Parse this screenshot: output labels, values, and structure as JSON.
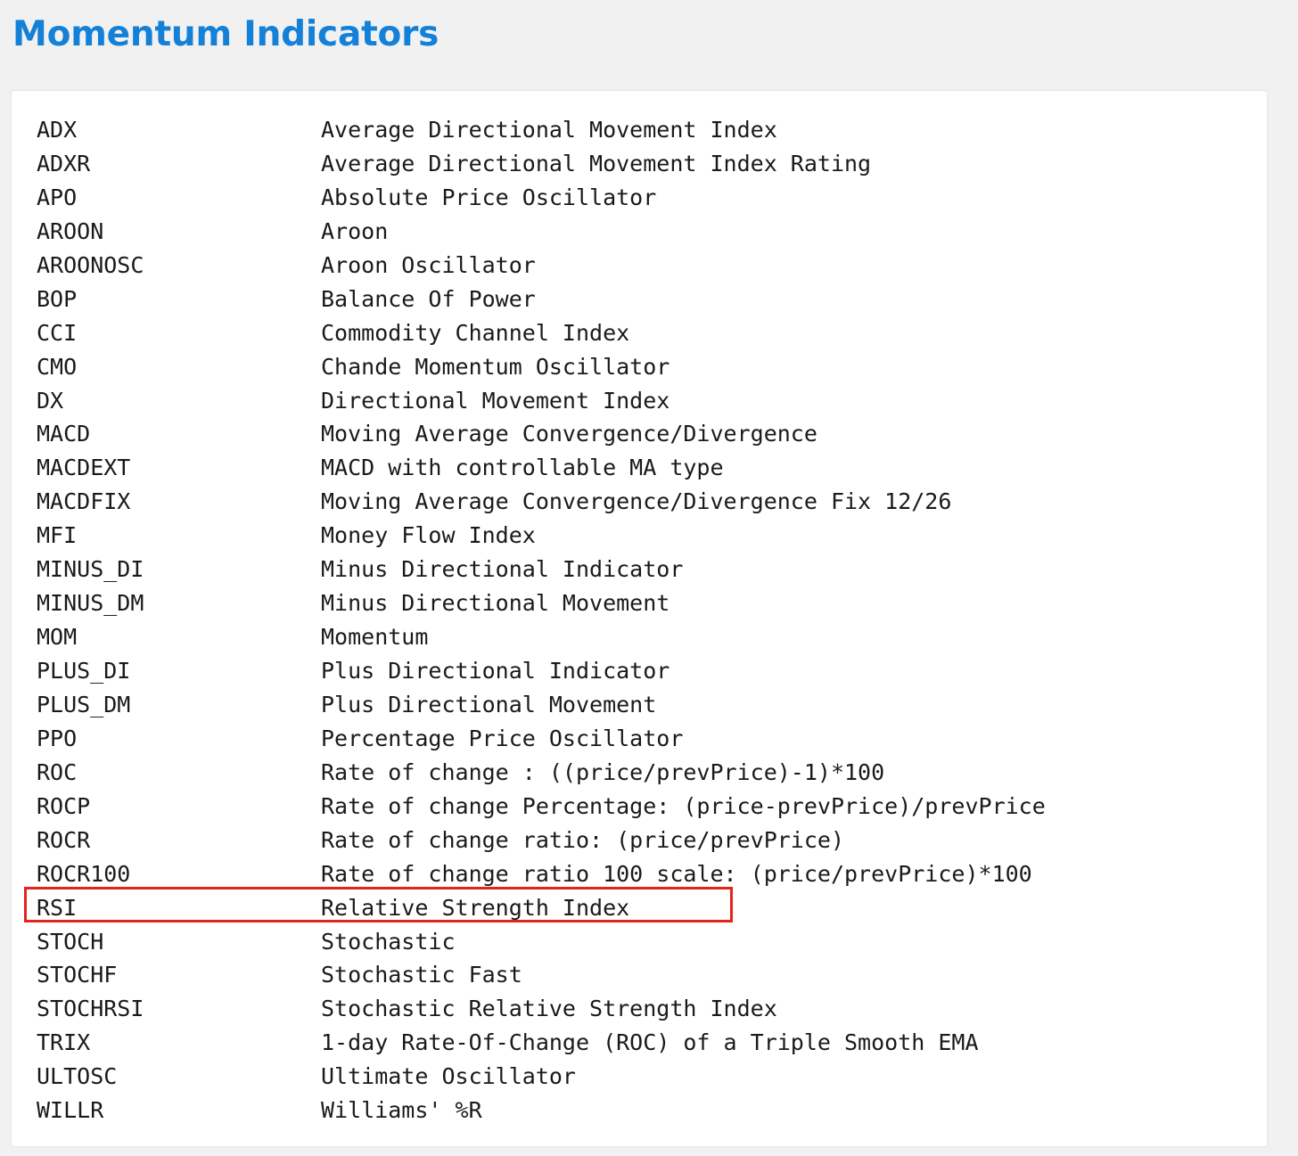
{
  "page": {
    "title": "Momentum Indicators",
    "title_color": "#1480d8",
    "highlight_color": "#e3251b",
    "highlighted_code": "RSI"
  },
  "indicators": [
    {
      "code": "ADX",
      "description": "Average Directional Movement Index"
    },
    {
      "code": "ADXR",
      "description": "Average Directional Movement Index Rating"
    },
    {
      "code": "APO",
      "description": "Absolute Price Oscillator"
    },
    {
      "code": "AROON",
      "description": "Aroon"
    },
    {
      "code": "AROONOSC",
      "description": "Aroon Oscillator"
    },
    {
      "code": "BOP",
      "description": "Balance Of Power"
    },
    {
      "code": "CCI",
      "description": "Commodity Channel Index"
    },
    {
      "code": "CMO",
      "description": "Chande Momentum Oscillator"
    },
    {
      "code": "DX",
      "description": "Directional Movement Index"
    },
    {
      "code": "MACD",
      "description": "Moving Average Convergence/Divergence"
    },
    {
      "code": "MACDEXT",
      "description": "MACD with controllable MA type"
    },
    {
      "code": "MACDFIX",
      "description": "Moving Average Convergence/Divergence Fix 12/26"
    },
    {
      "code": "MFI",
      "description": "Money Flow Index"
    },
    {
      "code": "MINUS_DI",
      "description": "Minus Directional Indicator"
    },
    {
      "code": "MINUS_DM",
      "description": "Minus Directional Movement"
    },
    {
      "code": "MOM",
      "description": "Momentum"
    },
    {
      "code": "PLUS_DI",
      "description": "Plus Directional Indicator"
    },
    {
      "code": "PLUS_DM",
      "description": "Plus Directional Movement"
    },
    {
      "code": "PPO",
      "description": "Percentage Price Oscillator"
    },
    {
      "code": "ROC",
      "description": "Rate of change : ((price/prevPrice)-1)*100"
    },
    {
      "code": "ROCP",
      "description": "Rate of change Percentage: (price-prevPrice)/prevPrice"
    },
    {
      "code": "ROCR",
      "description": "Rate of change ratio: (price/prevPrice)"
    },
    {
      "code": "ROCR100",
      "description": "Rate of change ratio 100 scale: (price/prevPrice)*100"
    },
    {
      "code": "RSI",
      "description": "Relative Strength Index"
    },
    {
      "code": "STOCH",
      "description": "Stochastic"
    },
    {
      "code": "STOCHF",
      "description": "Stochastic Fast"
    },
    {
      "code": "STOCHRSI",
      "description": "Stochastic Relative Strength Index"
    },
    {
      "code": "TRIX",
      "description": "1-day Rate-Of-Change (ROC) of a Triple Smooth EMA"
    },
    {
      "code": "ULTOSC",
      "description": "Ultimate Oscillator"
    },
    {
      "code": "WILLR",
      "description": "Williams' %R"
    }
  ]
}
